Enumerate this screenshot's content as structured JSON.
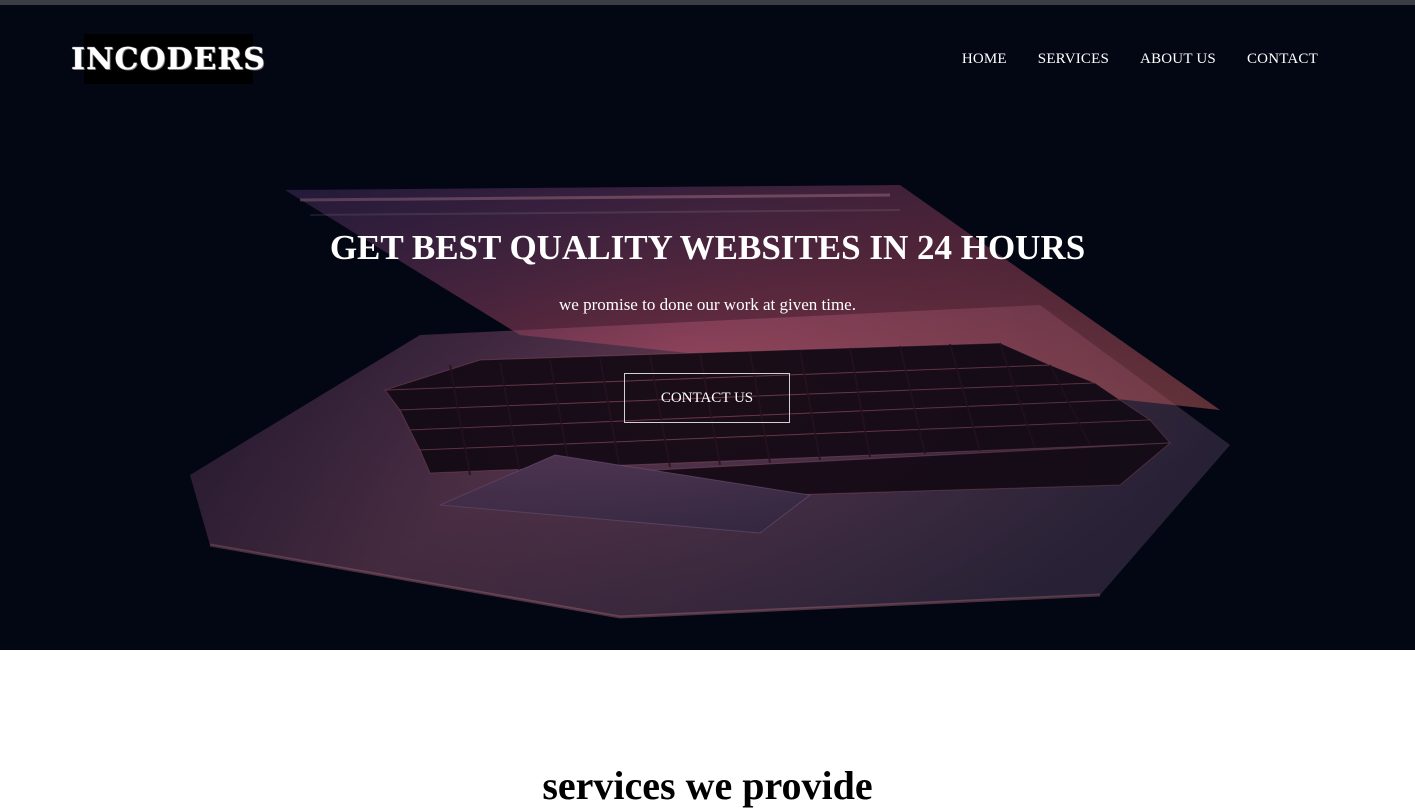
{
  "brand": {
    "logo_text": "INCODERS"
  },
  "nav": {
    "items": [
      "HOME",
      "SERVICES",
      "ABOUT US",
      "CONTACT"
    ]
  },
  "hero": {
    "title": "GET BEST QUALITY WEBSITES IN 24 HOURS",
    "subtitle": "we promise to done our work at given time.",
    "cta_label": "CONTACT US",
    "background_image": "laptop-keyboard-photo"
  },
  "services": {
    "title": "services we provide"
  },
  "colors": {
    "hero_bg": "#030714",
    "text_light": "#ffffff",
    "text_dark": "#000000",
    "accent_glow": "#c0455a"
  }
}
